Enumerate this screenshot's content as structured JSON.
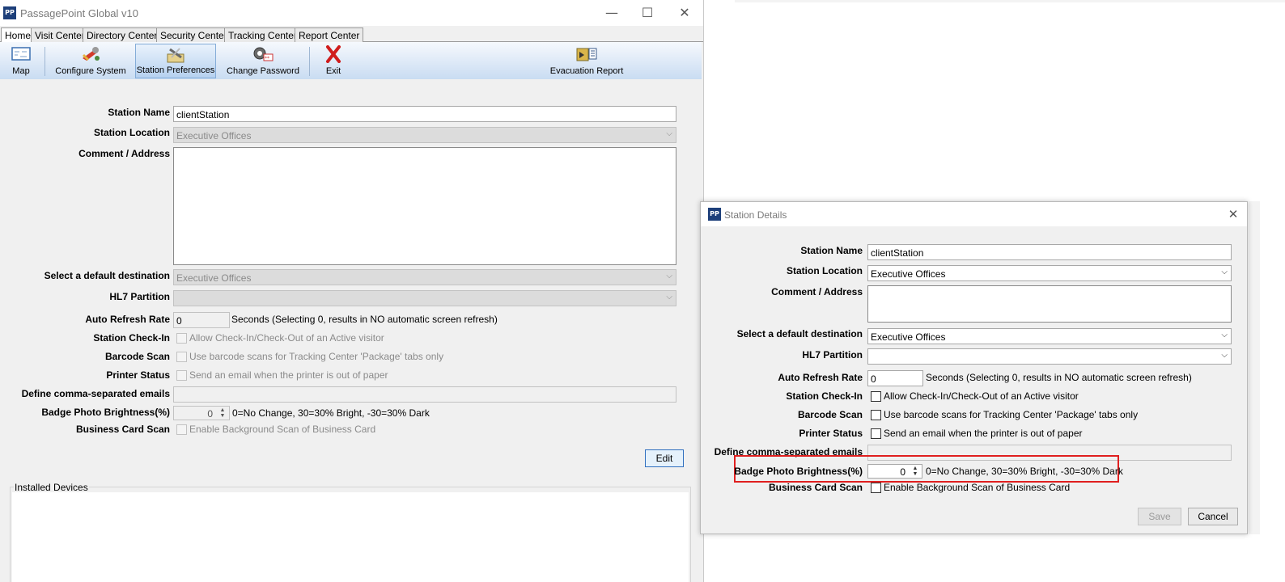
{
  "main_window": {
    "title": "PassagePoint Global v10",
    "logo_text": "PP",
    "controls": {
      "minimize": "—",
      "maximize": "☐",
      "close": "✕"
    },
    "tabs": [
      {
        "label": "Home",
        "active": true
      },
      {
        "label": "Visit Center",
        "active": false
      },
      {
        "label": "Directory Center",
        "active": false
      },
      {
        "label": "Security Center",
        "active": false
      },
      {
        "label": "Tracking Center",
        "active": false
      },
      {
        "label": "Report Center",
        "active": false
      }
    ],
    "toolbar": {
      "map": "Map",
      "configure_system": "Configure System",
      "station_preferences": "Station Preferences",
      "change_password": "Change Password",
      "exit": "Exit",
      "evacuation_report": "Evacuation Report"
    },
    "form": {
      "station_name_label": "Station Name",
      "station_name_value": "clientStation",
      "station_location_label": "Station Location",
      "station_location_value": "Executive Offices",
      "comment_label": "Comment / Address",
      "comment_value": "",
      "default_destination_label": "Select a default destination",
      "default_destination_value": "Executive Offices",
      "hl7_label": "HL7 Partition",
      "hl7_value": "",
      "auto_refresh_label": "Auto Refresh Rate",
      "auto_refresh_value": "0",
      "auto_refresh_hint": "Seconds (Selecting 0, results in NO automatic screen refresh)",
      "checkin_label": "Station Check-In",
      "checkin_hint": "Allow Check-In/Check-Out of an Active visitor",
      "barcode_label": "Barcode Scan",
      "barcode_hint": "Use barcode scans for Tracking Center 'Package' tabs only",
      "printer_label": "Printer Status",
      "printer_hint": "Send an email when the printer is out of paper",
      "emails_label": "Define comma-separated emails",
      "emails_value": "",
      "brightness_label": "Badge Photo Brightness(%)",
      "brightness_value": "0",
      "brightness_hint": "0=No Change, 30=30% Bright, -30=30% Dark",
      "business_card_label": "Business Card Scan",
      "business_card_hint": "Enable Background Scan of Business Card",
      "edit_button": "Edit",
      "installed_devices": "Installed Devices"
    }
  },
  "dialog": {
    "title": "Station Details",
    "logo_text": "PP",
    "close": "✕",
    "form": {
      "station_name_label": "Station Name",
      "station_name_value": "clientStation",
      "station_location_label": "Station Location",
      "station_location_value": "Executive Offices",
      "comment_label": "Comment / Address",
      "comment_value": "",
      "default_destination_label": "Select a default destination",
      "default_destination_value": "Executive Offices",
      "hl7_label": "HL7 Partition",
      "hl7_value": "",
      "auto_refresh_label": "Auto Refresh Rate",
      "auto_refresh_value": "0",
      "auto_refresh_hint": "Seconds (Selecting 0, results in NO automatic screen refresh)",
      "checkin_label": "Station Check-In",
      "checkin_hint": "Allow Check-In/Check-Out of an Active visitor",
      "barcode_label": "Barcode Scan",
      "barcode_hint": "Use barcode scans for Tracking Center 'Package' tabs only",
      "printer_label": "Printer Status",
      "printer_hint": "Send an email when the printer is out of paper",
      "emails_label": "Define comma-separated emails",
      "emails_value": "",
      "brightness_label": "Badge Photo Brightness(%)",
      "brightness_value": "0",
      "brightness_hint": "0=No Change, 30=30% Bright, -30=30% Dark",
      "business_card_label": "Business Card Scan",
      "business_card_hint": "Enable Background Scan of Business Card",
      "save_button": "Save",
      "cancel_button": "Cancel"
    }
  },
  "colors": {
    "highlight": "#e01f1f",
    "toolbar_top": "#f6f9fd",
    "toolbar_bottom": "#c9dcf2",
    "brand": "#1d3f7a"
  },
  "icons": [
    "app-logo-icon",
    "map-icon",
    "configure-system-icon",
    "station-preferences-icon",
    "change-password-icon",
    "exit-icon",
    "evacuation-report-icon",
    "dropdown-arrow-icon",
    "spinner-arrows-icon",
    "close-icon"
  ]
}
